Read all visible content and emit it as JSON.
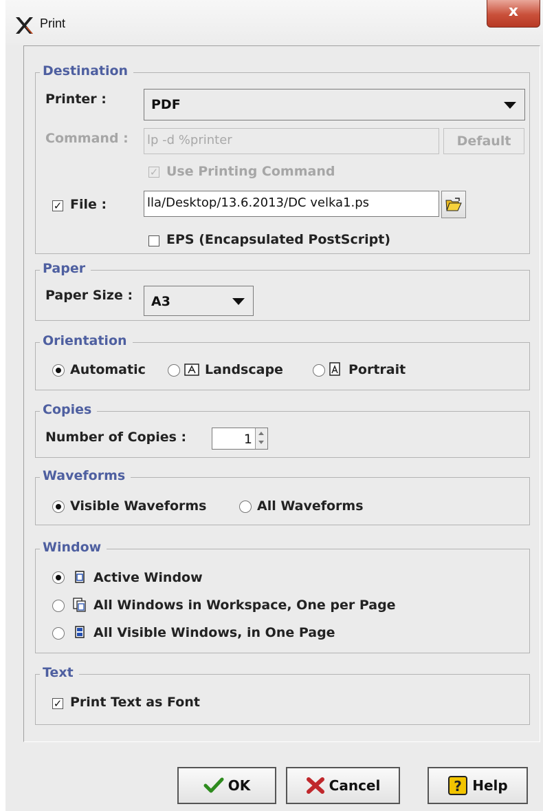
{
  "window": {
    "title": "Print",
    "close_label": "x"
  },
  "destination": {
    "legend": "Destination",
    "printer_label": "Printer :",
    "printer_value": "PDF",
    "command_label": "Command :",
    "command_value": "lp -d %printer",
    "default_button": "Default",
    "use_printing_command_label": "Use Printing Command",
    "use_printing_command_checked": true,
    "file_label": "File :",
    "file_checked": true,
    "file_value": "lla/Desktop/13.6.2013/DC velka1.ps",
    "eps_label": "EPS (Encapsulated PostScript)",
    "eps_checked": false
  },
  "paper": {
    "legend": "Paper",
    "size_label": "Paper Size :",
    "size_value": "A3"
  },
  "orientation": {
    "legend": "Orientation",
    "options": [
      "Automatic",
      "Landscape",
      "Portrait"
    ],
    "selected": "Automatic"
  },
  "copies": {
    "legend": "Copies",
    "label": "Number of Copies :",
    "value": "1"
  },
  "waveforms": {
    "legend": "Waveforms",
    "options": [
      "Visible Waveforms",
      "All Waveforms"
    ],
    "selected": "Visible Waveforms"
  },
  "window_group": {
    "legend": "Window",
    "options": [
      "Active Window",
      "All Windows in Workspace, One per Page",
      "All Visible Windows, in One Page"
    ],
    "selected": "Active Window"
  },
  "text_group": {
    "legend": "Text",
    "print_text_as_font_label": "Print Text as Font",
    "print_text_as_font_checked": true
  },
  "buttons": {
    "ok": "OK",
    "cancel": "Cancel",
    "help": "Help"
  },
  "colors": {
    "legend_text": "#4e5fa0",
    "dialog_bg": "#ebebeb",
    "close_button": "#c9503a",
    "ok_check": "#2e8b1e",
    "cancel_x": "#c0282c",
    "help_icon": "#f2c400"
  }
}
